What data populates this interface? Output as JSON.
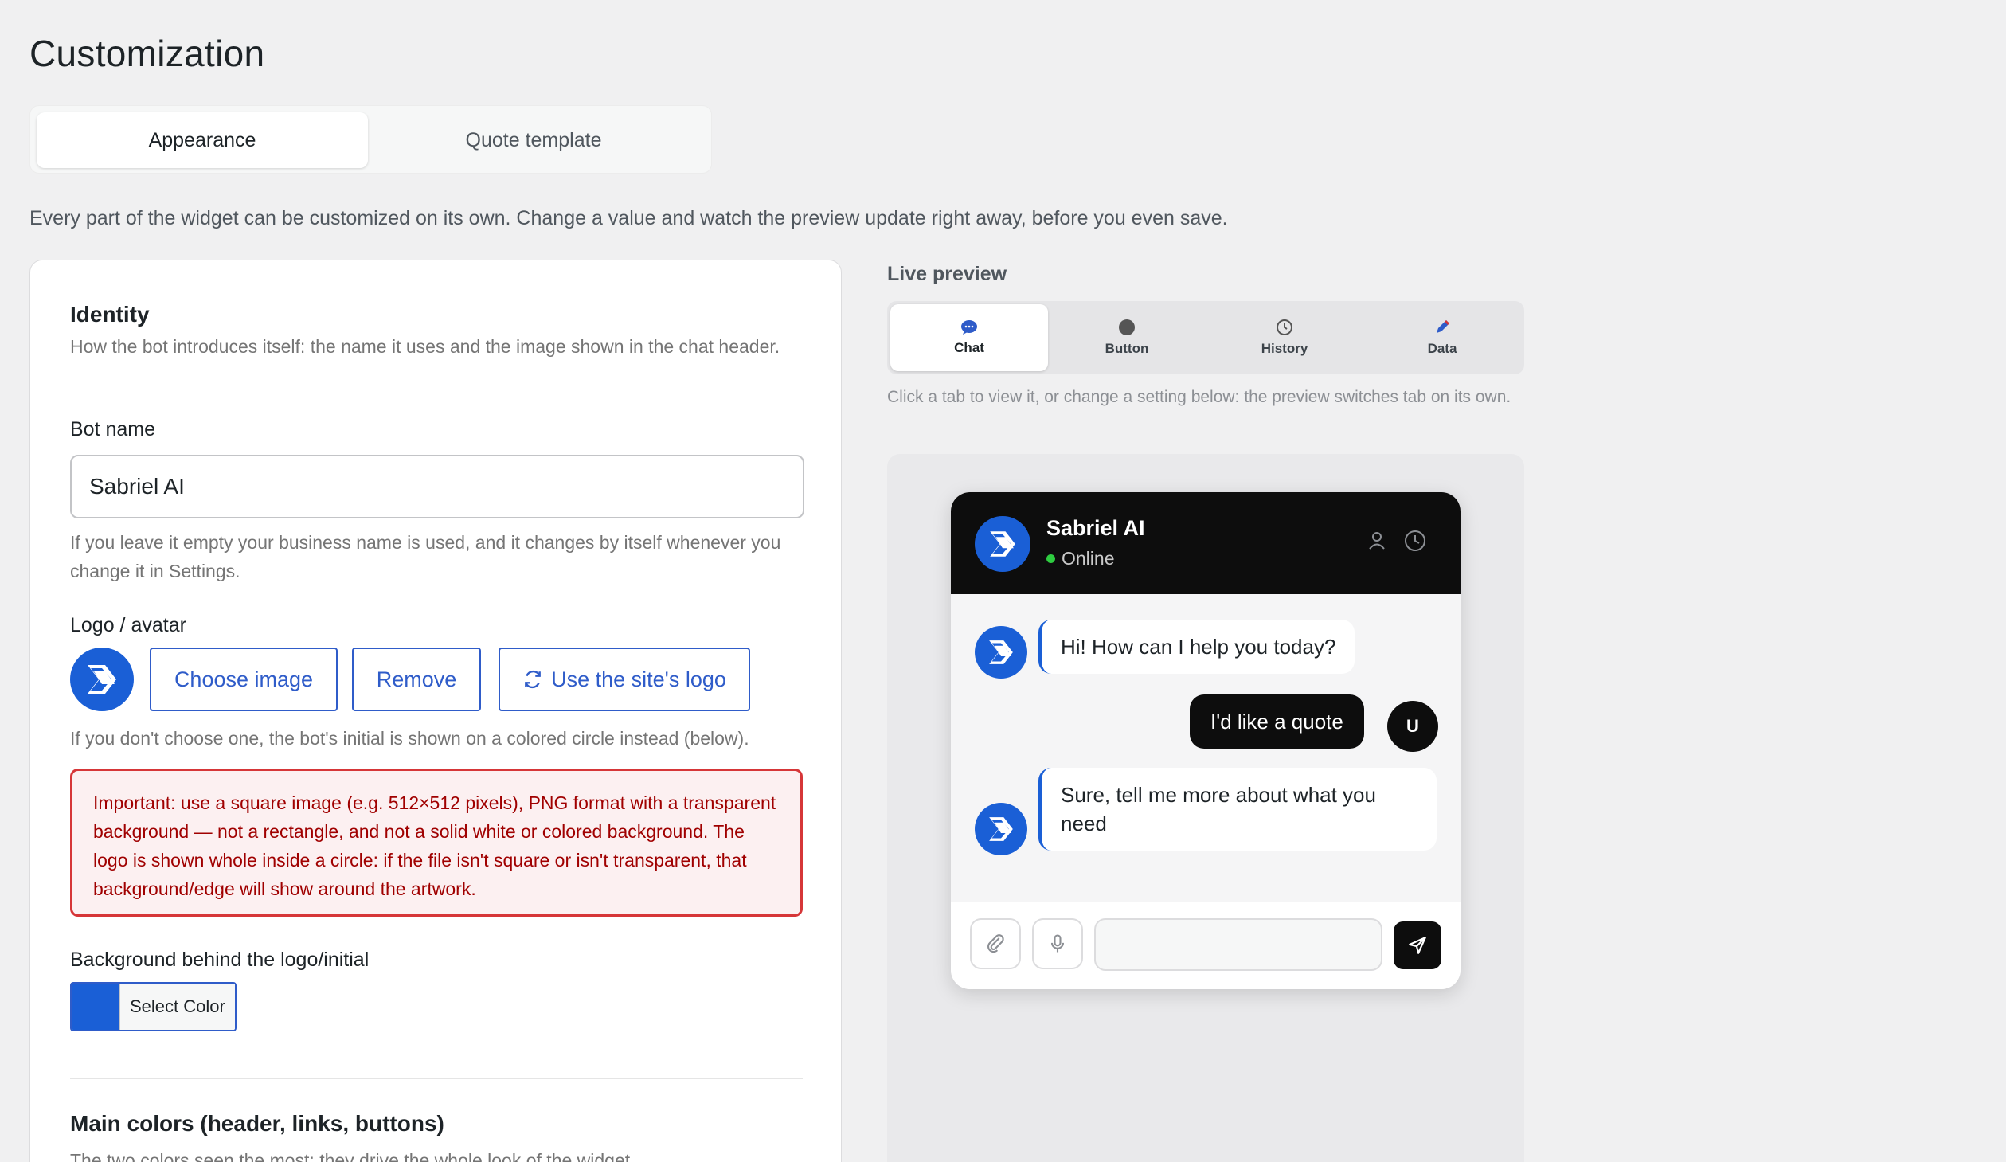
{
  "page": {
    "title": "Customization",
    "intro": "Every part of the widget can be customized on its own. Change a value and watch the preview update right away, before you even save."
  },
  "tabs": [
    {
      "label": "Appearance",
      "active": true
    },
    {
      "label": "Quote template",
      "active": false
    }
  ],
  "identity": {
    "title": "Identity",
    "description": "How the bot introduces itself: the name it uses and the image shown in the chat header.",
    "bot_name_label": "Bot name",
    "bot_name_value": "Sabriel AI",
    "bot_name_help": "If you leave it empty your business name is used, and it changes by itself whenever you change it in Settings.",
    "logo_label": "Logo / avatar",
    "choose_image": "Choose image",
    "remove": "Remove",
    "use_site_logo": "Use the site's logo",
    "logo_help": "If you don't choose one, the bot's initial is shown on a colored circle instead (below).",
    "notice": "Important: use a square image (e.g. 512×512 pixels), PNG format with a transparent background — not a rectangle, and not a solid white or colored background. The logo is shown whole inside a circle: if the file isn't square or isn't transparent, that background/edge will show around the artwork.",
    "bg_label": "Background behind the logo/initial",
    "select_color": "Select Color",
    "bg_color": "#1a5fd6"
  },
  "main_colors": {
    "title": "Main colors (header, links, buttons)",
    "description": "The two colors seen the most: they drive the whole look of the widget."
  },
  "preview": {
    "title": "Live preview",
    "tabs": [
      {
        "label": "Chat",
        "icon": "chat-bubble-icon",
        "active": true
      },
      {
        "label": "Button",
        "icon": "circle-icon",
        "active": false
      },
      {
        "label": "History",
        "icon": "clock-icon",
        "active": false
      },
      {
        "label": "Data",
        "icon": "pencil-icon",
        "active": false
      }
    ],
    "help": "Click a tab to view it, or change a setting below: the preview switches tab on its own.",
    "chat": {
      "bot_name": "Sabriel AI",
      "status": "Online",
      "messages": [
        {
          "from": "bot",
          "text": "Hi! How can I help you today?"
        },
        {
          "from": "user",
          "text": "I'd like a quote"
        },
        {
          "from": "bot",
          "text": "Sure, tell me more about what you need"
        }
      ],
      "user_initial": "U"
    }
  },
  "colors": {
    "accent": "#2f5cc9",
    "brand_blue": "#1a5fd6",
    "notice_red": "#d63638",
    "header_black": "#0d0d0d",
    "online_green": "#2ecc40"
  }
}
